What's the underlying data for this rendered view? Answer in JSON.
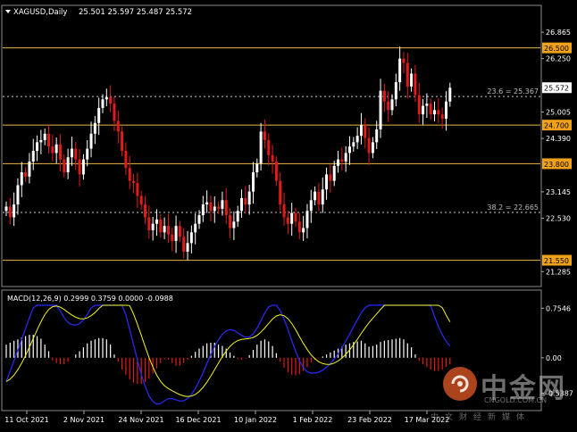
{
  "header": {
    "symbol": "XAGUSD,Daily",
    "ohlc": "25.501 25.597 25.487 25.572"
  },
  "macd_header": "MACD(12,26,9) 0.2999 0.3759 0.0000 -0.0988",
  "colors": {
    "background": "#000000",
    "bull": "#ffffff",
    "bear": "#e21a1a",
    "level_line": "#e8b84a",
    "level_tag_bg": "#f0a11a",
    "price_tag_bg": "#ffffff",
    "macd_line": "#2a2aff",
    "signal_line": "#f4f41a",
    "axis_text": "#ffffff",
    "grid_dashed": "#cccccc"
  },
  "watermark": {
    "brand_cn": "中金网",
    "brand_en": "CNGOLD.COM.CN",
    "tagline": "中文财经新媒体"
  },
  "chart_data": [
    {
      "type": "candlestick",
      "title": "XAGUSD,Daily",
      "y_ticks": [
        "26.865",
        "26.250",
        "25.005",
        "24.390",
        "23.145",
        "22.530",
        "21.285"
      ],
      "y_tick_values": [
        26.865,
        26.25,
        25.005,
        24.39,
        23.145,
        22.53,
        21.285
      ],
      "ylim": [
        21.0,
        27.2
      ],
      "x_ticks": [
        "11 Oct 2021",
        "2 Nov 2021",
        "24 Nov 2021",
        "16 Dec 2021",
        "10 Jan 2022",
        "1 Feb 2022",
        "23 Feb 2022",
        "17 Mar 2022"
      ],
      "horizontal_levels": [
        {
          "label": "26.500",
          "value": 26.5
        },
        {
          "label": "24.700",
          "value": 24.7
        },
        {
          "label": "23.800",
          "value": 23.8
        },
        {
          "label": "21.550",
          "value": 21.55
        }
      ],
      "fibonacci_levels": [
        {
          "label": "23.6 = 25.367",
          "value": 25.367
        },
        {
          "label": "38.2 = 22.665",
          "value": 22.665
        }
      ],
      "current_price": {
        "label": "25.572",
        "value": 25.572
      },
      "closes": [
        22.8,
        22.55,
        22.85,
        23.3,
        23.6,
        23.5,
        23.85,
        24.1,
        24.3,
        24.35,
        24.5,
        24.2,
        24.05,
        24.25,
        23.9,
        23.6,
        23.95,
        24.15,
        23.9,
        23.55,
        23.9,
        24.15,
        24.5,
        24.75,
        25.1,
        25.3,
        25.35,
        25.2,
        24.8,
        24.55,
        24.1,
        23.7,
        23.4,
        23.35,
        23.05,
        22.85,
        22.55,
        22.25,
        22.4,
        22.5,
        22.2,
        22.35,
        22.15,
        22.0,
        22.35,
        22.1,
        21.75,
        21.95,
        22.2,
        22.4,
        22.6,
        22.85,
        22.9,
        22.7,
        22.8,
        22.75,
        22.95,
        22.6,
        22.3,
        22.45,
        22.7,
        23.0,
        22.85,
        23.15,
        23.6,
        23.8,
        24.55,
        24.35,
        24.0,
        23.85,
        23.4,
        22.85,
        22.55,
        22.4,
        22.65,
        22.45,
        22.2,
        22.3,
        22.7,
        22.95,
        23.15,
        22.85,
        23.2,
        23.55,
        23.4,
        23.75,
        23.9,
        23.85,
        24.05,
        24.2,
        24.3,
        24.45,
        24.7,
        24.4,
        24.05,
        24.3,
        24.6,
        25.5,
        25.25,
        25.05,
        25.3,
        25.7,
        26.25,
        26.15,
        25.6,
        25.9,
        25.4,
        24.95,
        25.15,
        25.2,
        24.95,
        25.05,
        24.95,
        24.85,
        25.25,
        25.57
      ]
    },
    {
      "type": "bar",
      "title": "MACD(12,26,9)",
      "y_ticks": [
        "0.7546",
        "0.00",
        "-0.5387"
      ],
      "y_tick_values": [
        0.7546,
        0.0,
        -0.5387
      ],
      "ylim": [
        -0.75,
        0.8
      ],
      "histogram": [
        0.2,
        0.23,
        0.26,
        0.28,
        0.31,
        0.33,
        0.35,
        0.35,
        0.33,
        0.29,
        0.2,
        0.1,
        -0.04,
        -0.08,
        -0.1,
        -0.1,
        -0.06,
        0.0,
        0.05,
        0.1,
        0.16,
        0.22,
        0.26,
        0.28,
        0.3,
        0.3,
        0.28,
        0.2,
        0.05,
        -0.06,
        -0.18,
        -0.26,
        -0.33,
        -0.38,
        -0.4,
        -0.4,
        -0.37,
        -0.32,
        -0.24,
        -0.16,
        -0.08,
        -0.02,
        -0.03,
        -0.08,
        -0.12,
        -0.12,
        -0.08,
        -0.03,
        0.03,
        0.09,
        0.14,
        0.18,
        0.22,
        0.23,
        0.23,
        0.2,
        0.18,
        0.14,
        0.08,
        0.03,
        -0.02,
        -0.03,
        -0.01,
        0.04,
        0.12,
        0.2,
        0.26,
        0.28,
        0.25,
        0.18,
        0.07,
        -0.06,
        -0.15,
        -0.22,
        -0.26,
        -0.27,
        -0.25,
        -0.2,
        -0.14,
        -0.07,
        -0.03,
        -0.01,
        0.02,
        0.05,
        0.08,
        0.11,
        0.14,
        0.17,
        0.2,
        0.22,
        0.24,
        0.25,
        0.26,
        0.22,
        0.17,
        0.18,
        0.2,
        0.24,
        0.26,
        0.27,
        0.28,
        0.29,
        0.3,
        0.28,
        0.22,
        0.16,
        0.05,
        -0.05,
        -0.1,
        -0.14,
        -0.18,
        -0.2,
        -0.2,
        -0.18,
        -0.14,
        -0.1
      ]
    }
  ]
}
